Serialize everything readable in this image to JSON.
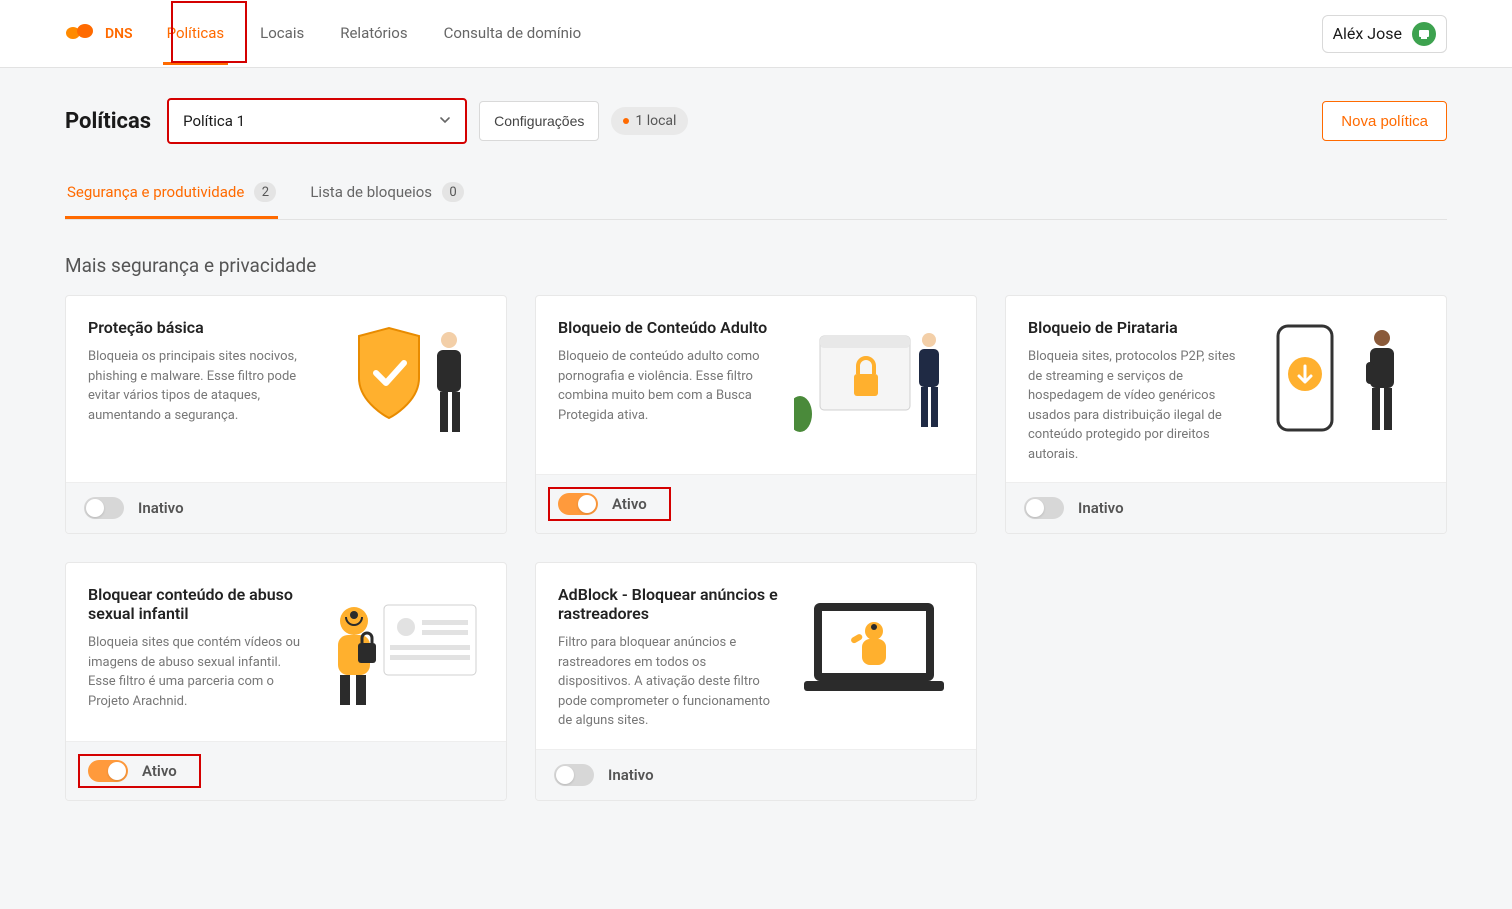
{
  "brand": {
    "name": "DNS"
  },
  "nav": {
    "items": [
      {
        "label": "Políticas",
        "active": true
      },
      {
        "label": "Locais",
        "active": false
      },
      {
        "label": "Relatórios",
        "active": false
      },
      {
        "label": "Consulta de domínio",
        "active": false
      }
    ]
  },
  "user": {
    "name": "Aléx Jose"
  },
  "page": {
    "title": "Políticas",
    "policy_selected": "Política 1",
    "config_button": "Configurações",
    "location_badge": "1 local",
    "new_button": "Nova política"
  },
  "tabs": [
    {
      "label": "Segurança e produtividade",
      "count": "2",
      "active": true
    },
    {
      "label": "Lista de bloqueios",
      "count": "0",
      "active": false
    }
  ],
  "section_title": "Mais segurança e privacidade",
  "status": {
    "active": "Ativo",
    "inactive": "Inativo"
  },
  "cards": [
    {
      "title": "Proteção básica",
      "desc": "Bloqueia os principais sites nocivos, phishing e malware. Esse filtro pode evitar vários tipos de ataques, aumentando a segurança.",
      "active": false,
      "highlight_toggle": false
    },
    {
      "title": "Bloqueio de Conteúdo Adulto",
      "desc": "Bloqueio de conteúdo adulto como pornografia e violência. Esse filtro combina muito bem com a Busca Protegida ativa.",
      "active": true,
      "highlight_toggle": true
    },
    {
      "title": "Bloqueio de Pirataria",
      "desc": "Bloqueia sites, protocolos P2P, sites de streaming e serviços de hospedagem de vídeo genéricos usados para distribuição ilegal de conteúdo protegido por direitos autorais.",
      "active": false,
      "highlight_toggle": false
    },
    {
      "title": "Bloquear conteúdo de abuso sexual infantil",
      "desc": "Bloqueia sites que contém vídeos ou imagens de abuso sexual infantil. Esse filtro é uma parceria com o Projeto Arachnid.",
      "active": true,
      "highlight_toggle": true
    },
    {
      "title": "AdBlock - Bloquear anúncios e rastreadores",
      "desc": "Filtro para bloquear anúncios e rastreadores em todos os dispositivos. A ativação deste filtro pode comprometer o funcionamento de alguns sites.",
      "active": false,
      "highlight_toggle": false
    }
  ]
}
